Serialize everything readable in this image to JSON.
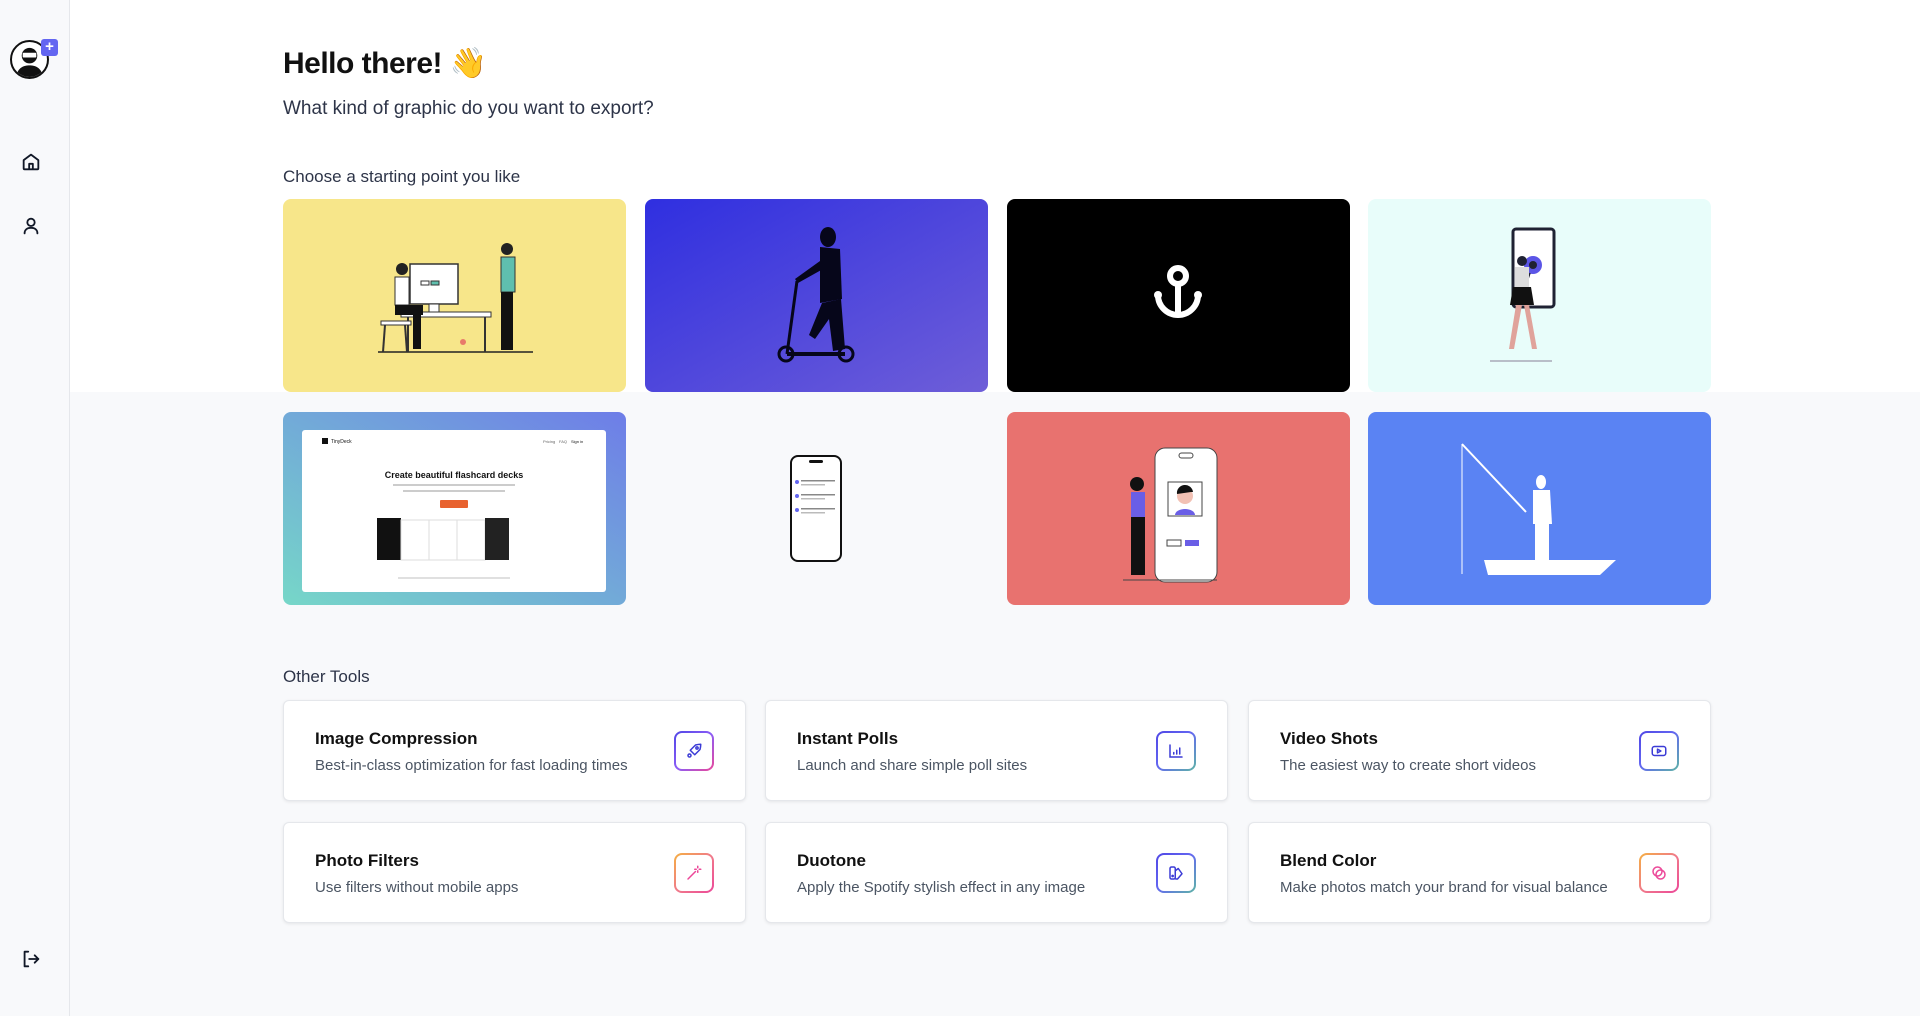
{
  "sidebar": {
    "items": [
      {
        "name": "profile",
        "icon": "avatar-icon",
        "badge": "+"
      },
      {
        "name": "home",
        "icon": "home-icon"
      },
      {
        "name": "account",
        "icon": "user-icon"
      },
      {
        "name": "logout",
        "icon": "logout-icon"
      }
    ]
  },
  "header": {
    "greeting": "Hello there! 👋",
    "subtitle": "What kind of graphic do you want to export?"
  },
  "templates": {
    "label": "Choose a starting point you like",
    "items": [
      {
        "name": "desk-illustration",
        "bg": "#f7e68a"
      },
      {
        "name": "scooter-silhouette",
        "bg": "#3b35d9"
      },
      {
        "name": "anchor-icon-graphic",
        "bg": "#000000"
      },
      {
        "name": "flower-frame-illustration",
        "bg": "#e8fdfa"
      },
      {
        "name": "flashcard-website-mockup",
        "bg": "#7cc7d8",
        "mockup": {
          "brand": "TinyDeck",
          "nav": [
            "Pricing",
            "FAQ",
            "Sign in"
          ],
          "headline": "Create beautiful flashcard decks"
        }
      },
      {
        "name": "phone-mockup",
        "bg": "#f8f9fb"
      },
      {
        "name": "phone-profile-illustration",
        "bg": "#e8726f"
      },
      {
        "name": "fishing-boat-silhouette",
        "bg": "#5a83f3"
      }
    ]
  },
  "tools": {
    "label": "Other Tools",
    "items": [
      {
        "title": "Image Compression",
        "desc": "Best-in-class optimization for fast loading times",
        "icon": "rocket-icon"
      },
      {
        "title": "Instant Polls",
        "desc": "Launch and share simple poll sites",
        "icon": "bar-chart-icon"
      },
      {
        "title": "Video Shots",
        "desc": "The easiest way to create short videos",
        "icon": "video-play-icon"
      },
      {
        "title": "Photo Filters",
        "desc": "Use filters without mobile apps",
        "icon": "magic-wand-icon"
      },
      {
        "title": "Duotone",
        "desc": "Apply the Spotify stylish effect in any image",
        "icon": "swatch-icon"
      },
      {
        "title": "Blend Color",
        "desc": "Make photos match your brand for visual balance",
        "icon": "blend-circles-icon"
      }
    ]
  }
}
